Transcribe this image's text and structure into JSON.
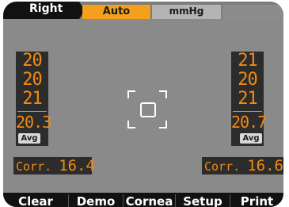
{
  "status_bar": {
    "eye": "Right",
    "mode": "Auto",
    "unit": "mmHg"
  },
  "left_panel": {
    "readings": [
      "20",
      "20",
      "21"
    ],
    "average": "20.3",
    "avg_label": "Avg",
    "corr_label": "Corr.",
    "corr_value": "16.4"
  },
  "right_panel": {
    "readings": [
      "21",
      "20",
      "21"
    ],
    "average": "20.7",
    "avg_label": "Avg",
    "corr_label": "Corr.",
    "corr_value": "16.6"
  },
  "softkeys": [
    "Clear",
    "Demo",
    "Cornea",
    "Setup",
    "Print"
  ],
  "colors": {
    "accent_orange": "#f28a12",
    "mode_tab": "#f4a01d",
    "screen_background": "#8a8a8a",
    "panel_background": "#2c2c2c"
  },
  "icons": {
    "focus_target": "alignment-target-icon"
  }
}
